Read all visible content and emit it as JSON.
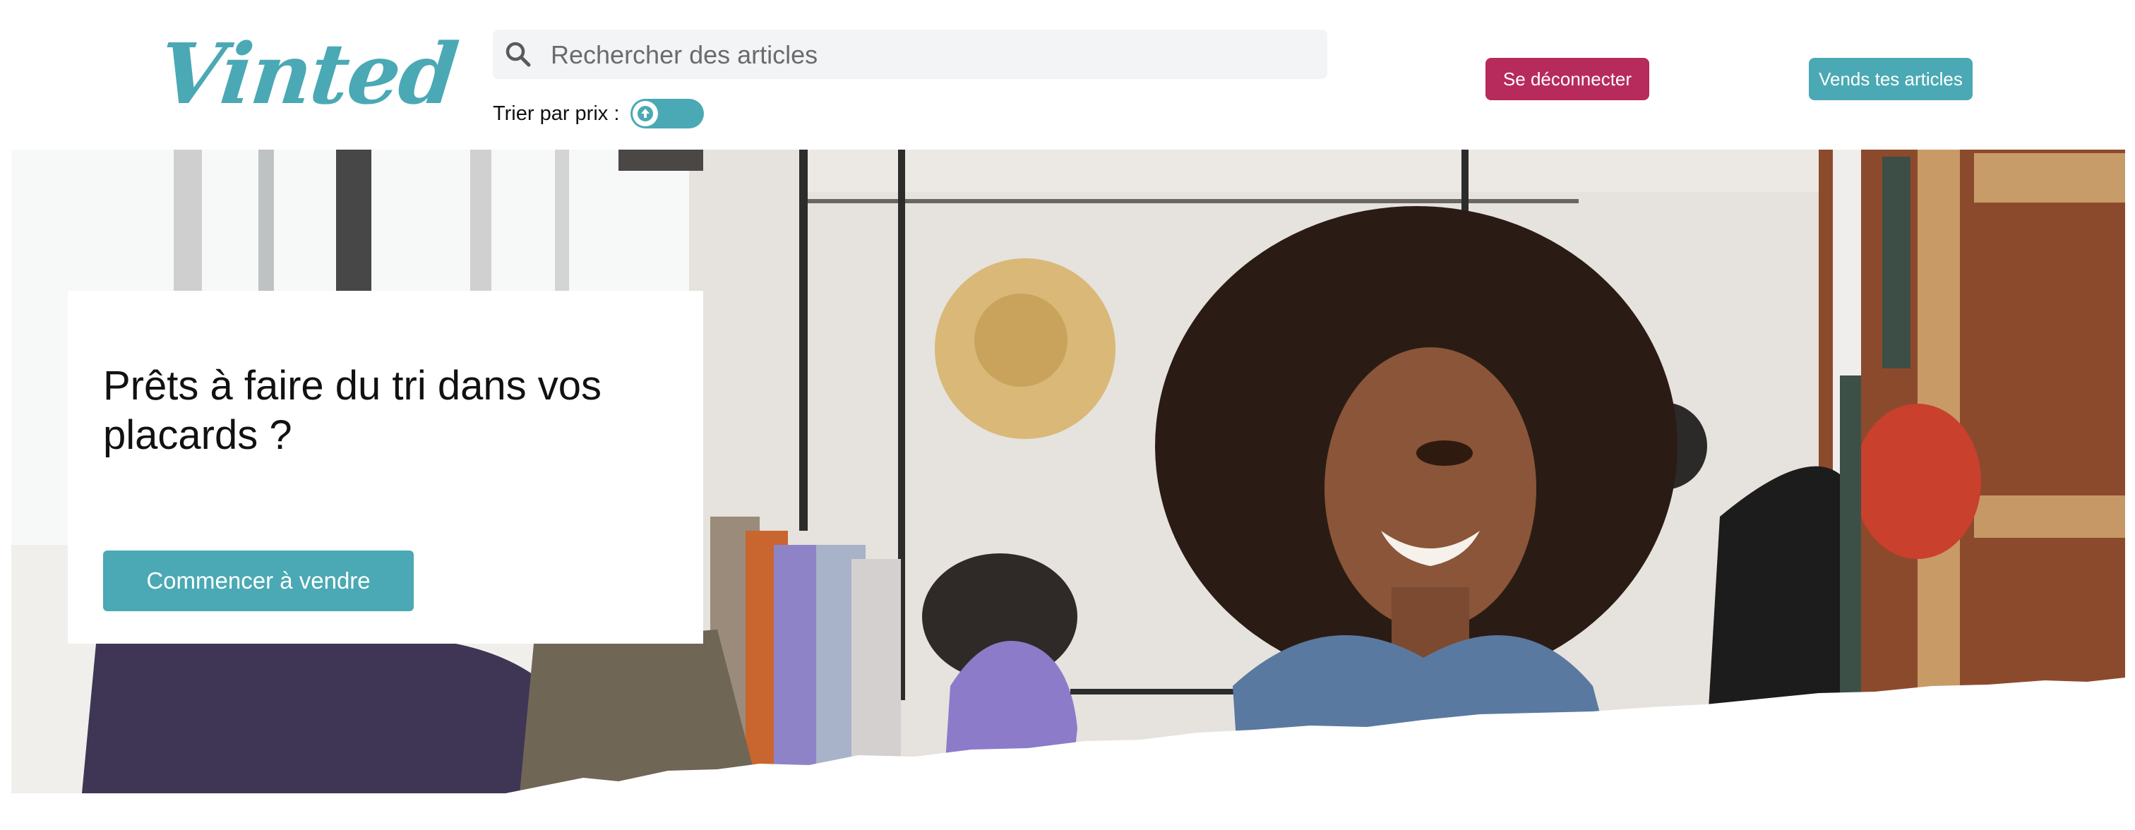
{
  "header": {
    "logo_text": "Vinted",
    "search": {
      "placeholder": "Rechercher des articles",
      "value": ""
    },
    "sort": {
      "label": "Trier par prix :",
      "toggle_state": "on",
      "toggle_icon": "arrow-up-icon"
    },
    "logout_label": "Se déconnecter",
    "sell_label": "Vends tes articles"
  },
  "hero": {
    "image": "woman-in-clothing-store-photo",
    "title": "Prêts à faire du tri dans vos placards ?",
    "cta_label": "Commencer à vendre"
  },
  "colors": {
    "brand": "#4aa9b4",
    "logout": "#b72a5c",
    "search_bg": "#f3f4f6"
  }
}
